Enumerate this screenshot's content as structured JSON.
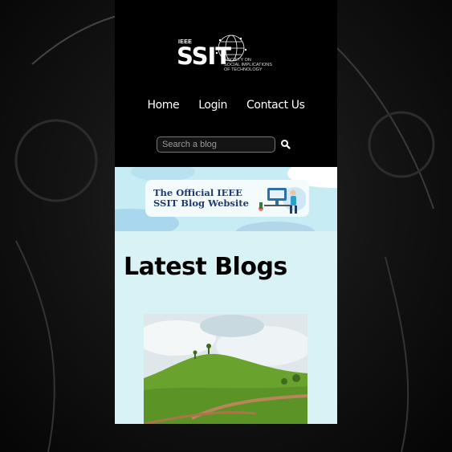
{
  "logo": {
    "org": "IEEE",
    "name": "SSIT",
    "tagline": "SOCIETY ON\nSOCIAL IMPLICATIONS\nOF TECHNOLOGY"
  },
  "nav": {
    "items": [
      {
        "label": "Home"
      },
      {
        "label": "Login"
      },
      {
        "label": "Contact Us"
      }
    ]
  },
  "search": {
    "placeholder": "Search a blog",
    "button_icon": "search-icon"
  },
  "banner": {
    "title": "The Official IEEE SSIT Blog Website"
  },
  "main": {
    "heading": "Latest Blogs",
    "posts": [
      {
        "image": "green-hill-landscape"
      }
    ]
  },
  "colors": {
    "page_bg": "#000000",
    "content_bg": "#d9f2f5",
    "banner_text": "#1e3a6e",
    "grass": "#6aa22e"
  }
}
